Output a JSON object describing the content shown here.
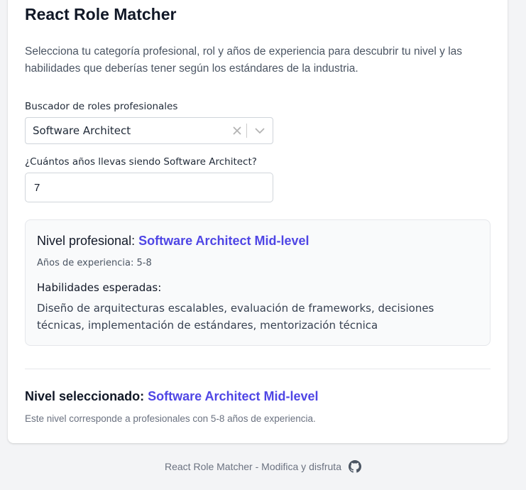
{
  "app": {
    "title": "React Role Matcher",
    "intro": "Selecciona tu categoría profesional, rol y años de experiencia para descubrir tu nivel y las habilidades que deberías tener según los estándares de la industria."
  },
  "role_search": {
    "label": "Buscador de roles profesionales",
    "value": "Software Architect",
    "clear_icon": "close-icon",
    "dropdown_icon": "chevron-down-icon"
  },
  "years": {
    "label": "¿Cuántos años llevas siendo Software Architect?",
    "value": "7"
  },
  "result": {
    "heading_prefix": "Nivel profesional:",
    "level": "Software Architect Mid-level",
    "years_text": "Años de experiencia: 5-8",
    "skills_heading": "Habilidades esperadas:",
    "skills": "Diseño de arquitecturas escalables, evaluación de frameworks, decisiones técnicas, implementación de estándares, mentorización técnica"
  },
  "selected": {
    "heading_prefix": "Nivel seleccionado:",
    "level": "Software Architect Mid-level",
    "note": "Este nivel corresponde a profesionales con 5-8 años de experiencia."
  },
  "footer": {
    "text": "React Role Matcher - Modifica y disfruta",
    "icon": "github-icon"
  },
  "colors": {
    "accent": "#4f46e5",
    "page_background": "#f3f4f6",
    "card_background": "#ffffff",
    "panel_background": "#f9fafb"
  }
}
